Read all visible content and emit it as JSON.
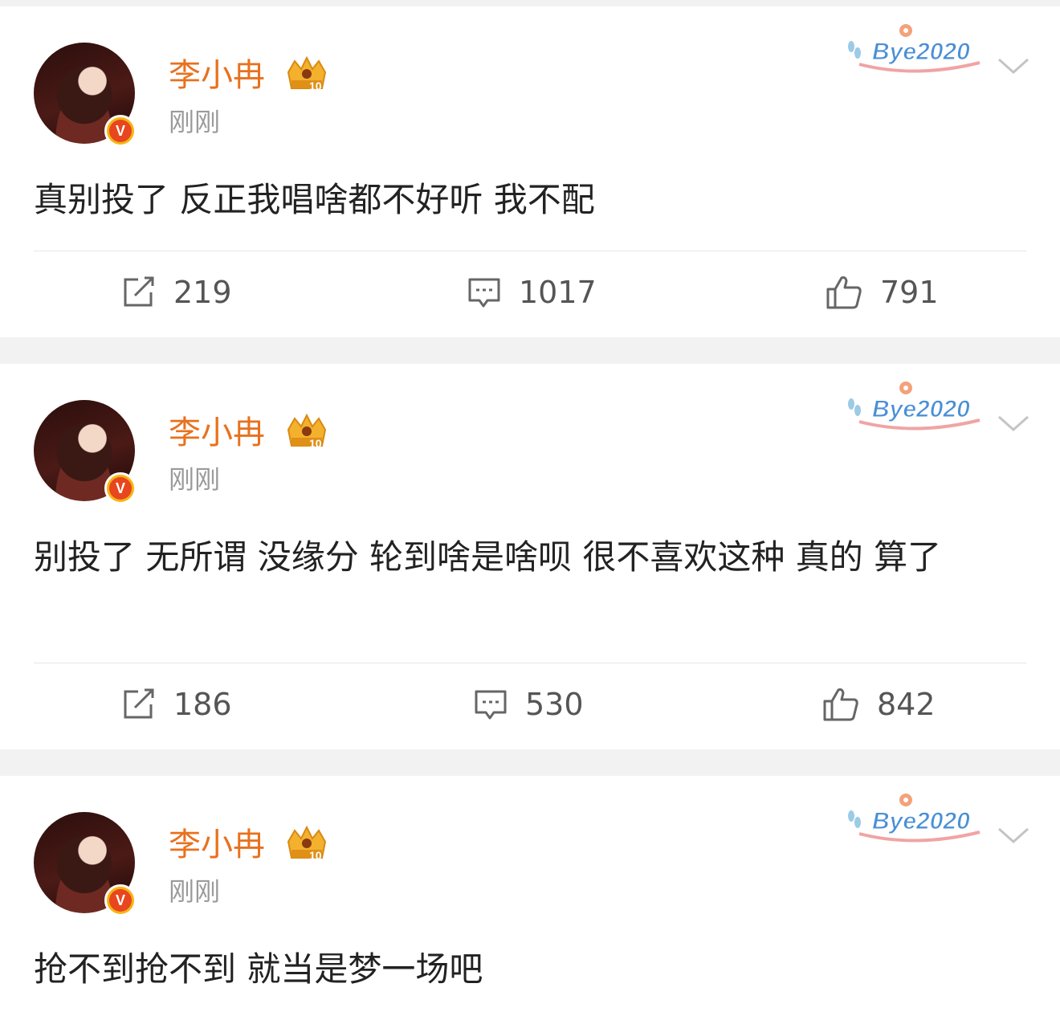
{
  "posts": [
    {
      "username": "李小冉",
      "time": "刚刚",
      "text": "真别投了 反正我唱啥都不好听 我不配",
      "badge_text": "Bye2020",
      "level_badge": "10",
      "reposts": "219",
      "comments": "1017",
      "likes": "791"
    },
    {
      "username": "李小冉",
      "time": "刚刚",
      "text": "别投了 无所谓 没缘分 轮到啥是啥呗 很不喜欢这种 真的 算了",
      "badge_text": "Bye2020",
      "level_badge": "10",
      "reposts": "186",
      "comments": "530",
      "likes": "842"
    },
    {
      "username": "李小冉",
      "time": "刚刚",
      "text": "抢不到抢不到 就当是梦一场吧",
      "badge_text": "Bye2020",
      "level_badge": "10"
    }
  ],
  "icons": {
    "verified": "verified-v-icon",
    "crown": "crown-level-icon",
    "more": "chevron-down-icon",
    "repost": "repost-icon",
    "comment": "comment-icon",
    "like": "thumbs-up-icon"
  },
  "colors": {
    "username": "#e8711e",
    "verified_outer": "#f6b514",
    "verified_inner": "#e8461e",
    "badge_text": "#4a8fd6",
    "badge_swoosh": "#f0a4a4"
  }
}
